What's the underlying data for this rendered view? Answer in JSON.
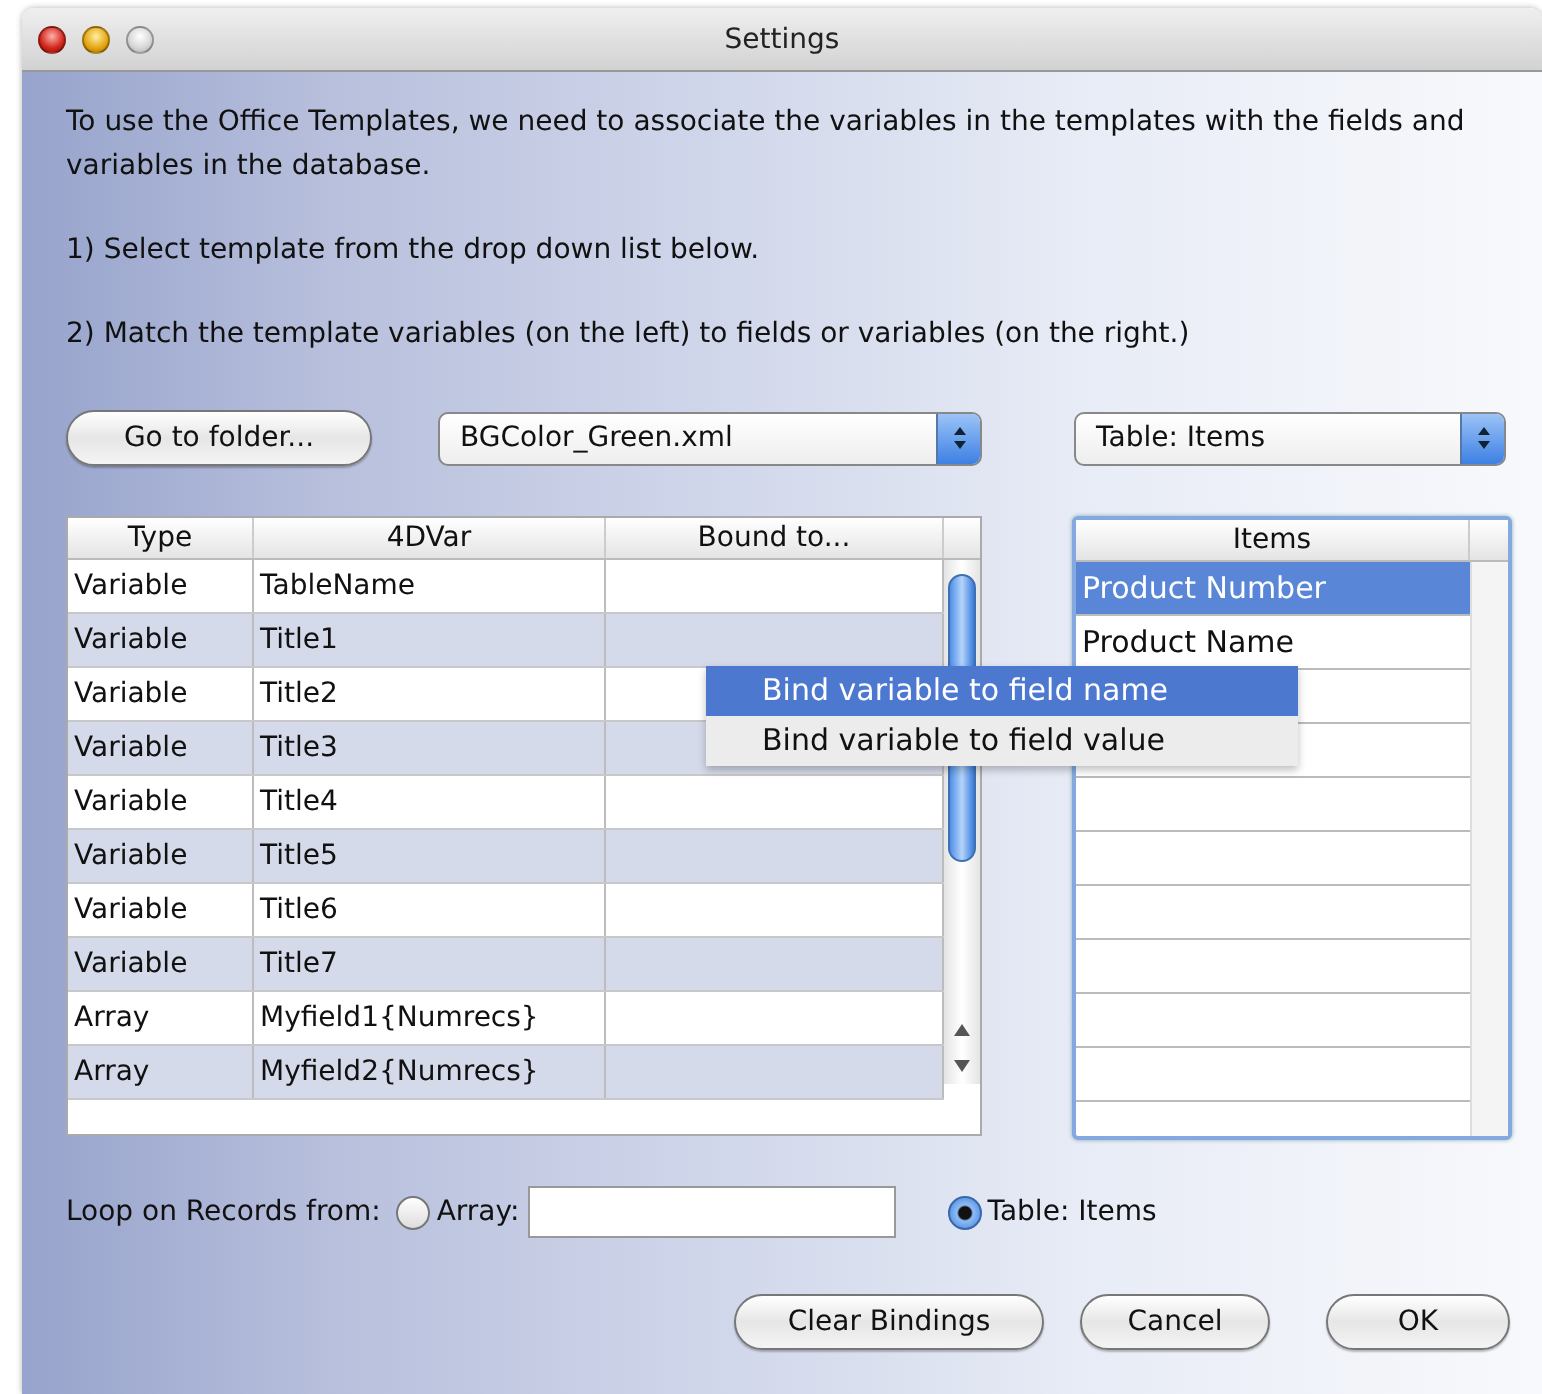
{
  "window": {
    "title": "Settings",
    "controls": [
      {
        "kind": "close"
      },
      {
        "kind": "minimize"
      },
      {
        "kind": "zoom"
      }
    ]
  },
  "instructions": [
    "To use the Office Templates, we need to associate the variables in the templates with the fields and variables in the database.",
    "1) Select  template from the drop down list below.",
    "2) Match the template variables (on the left) to fields or variables (on the right.)"
  ],
  "folder_button": "Go to folder...",
  "template_popup": {
    "value": "BGColor_Green.xml"
  },
  "table_popup": {
    "value": "Table: Items"
  },
  "bindings_table": {
    "columns": [
      "Type",
      "4DVar",
      "Bound to..."
    ],
    "rows": [
      {
        "type": "Variable",
        "var": "TableName"
      },
      {
        "type": "Variable",
        "var": "Title1"
      },
      {
        "type": "Variable",
        "var": "Title2"
      },
      {
        "type": "Variable",
        "var": "Title3"
      },
      {
        "type": "Variable",
        "var": "Title4"
      },
      {
        "type": "Variable",
        "var": "Title5"
      },
      {
        "type": "Variable",
        "var": "Title6"
      },
      {
        "type": "Variable",
        "var": "Title7"
      },
      {
        "type": "Array",
        "var": "Myfield1{Numrecs}"
      },
      {
        "type": "Array",
        "var": "Myfield2{Numrecs}"
      }
    ]
  },
  "items_list": {
    "header": "Items",
    "rows": [
      {
        "kind": "text",
        "text": "Product Number",
        "selected": true
      },
      {
        "kind": "text",
        "text": "Product Name",
        "selected": false
      },
      {
        "kind": "covered"
      },
      {
        "kind": "covered"
      }
    ]
  },
  "context_menu": {
    "items": [
      {
        "label": "Bind variable to field name",
        "selected": true
      },
      {
        "label": "Bind variable to field value",
        "selected": false
      }
    ]
  },
  "loop": {
    "label": "Loop on Records from:",
    "options": [
      {
        "kind": "field",
        "label": "Array:",
        "selected": false
      },
      {
        "kind": "plain",
        "label": "Table: Items",
        "selected": true
      }
    ]
  },
  "buttons": [
    "Clear Bindings",
    "Cancel",
    "OK"
  ]
}
